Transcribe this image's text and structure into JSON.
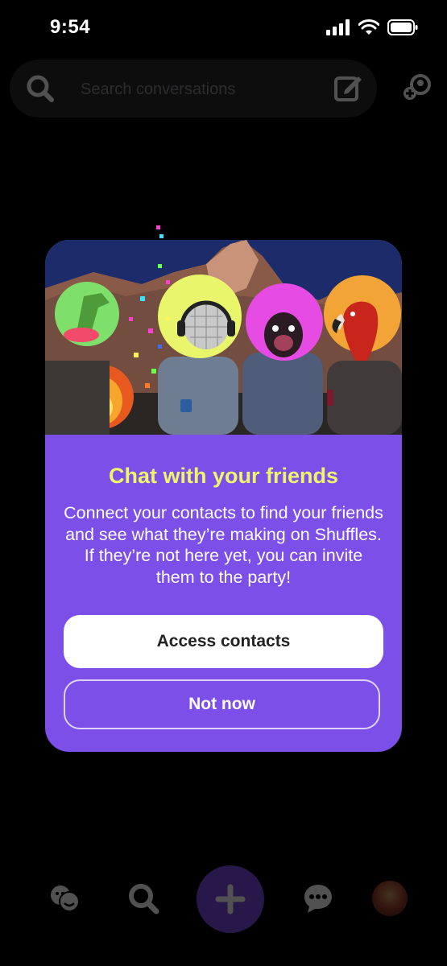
{
  "status_bar": {
    "time": "9:54"
  },
  "search": {
    "placeholder": "Search conversations"
  },
  "modal": {
    "title": "Chat with your friends",
    "body": "Connect your contacts to find your friends and see what they’re making on Shuffles. If they’re not here yet, you can invite them to the party!",
    "primary_button": "Access contacts",
    "secondary_button": "Not now",
    "hero_image": {
      "icons": [
        "dinosaur-head-icon",
        "disco-ball-head-icon",
        "pug-head-icon",
        "parrot-head-icon"
      ],
      "colors": {
        "sky": "#1c2c6b",
        "green_circle": "#7ee06a",
        "yellow_circle": "#e9f56a",
        "pink_circle": "#e64be3",
        "orange_circle": "#f2a536"
      }
    }
  },
  "bottom_nav": {
    "items": [
      "friends-icon",
      "search-icon",
      "create-plus-icon",
      "messages-icon",
      "profile-avatar"
    ]
  },
  "colors": {
    "modal_bg": "#7c4fe8",
    "title": "#eef56a",
    "fab": "#7a4ee6",
    "background": "#000000"
  }
}
